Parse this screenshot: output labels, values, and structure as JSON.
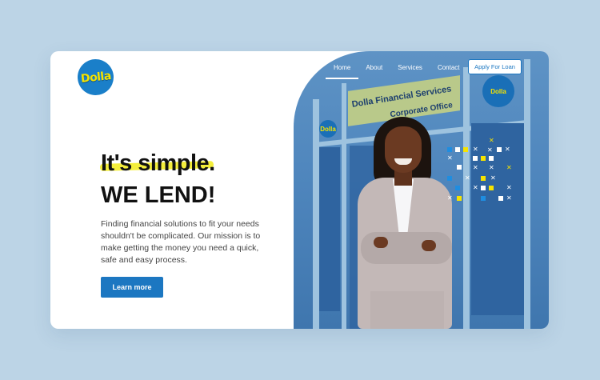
{
  "brand": {
    "logo_text": "Dolla"
  },
  "nav": {
    "items": [
      {
        "label": "Home",
        "active": true
      },
      {
        "label": "About",
        "active": false
      },
      {
        "label": "Services",
        "active": false
      },
      {
        "label": "Contact",
        "active": false
      }
    ],
    "cta_label": "Apply For Loan"
  },
  "hero": {
    "headline_1": "It's simple.",
    "headline_2": "WE LEND!",
    "description": "Finding financial solutions to fit your needs shouldn't be complicated. Our mission is to make getting the money you need a quick, safe and easy process.",
    "button_label": "Learn more"
  },
  "photo": {
    "sign_line_1": "Dolla Financial Services",
    "sign_line_2": "Corporate Office",
    "badge_text": "Dolla"
  },
  "colors": {
    "page_bg": "#bcd4e6",
    "accent_blue": "#1c77c1",
    "highlight_yellow": "#f4ee3c",
    "logo_yellow": "#f6e300"
  }
}
